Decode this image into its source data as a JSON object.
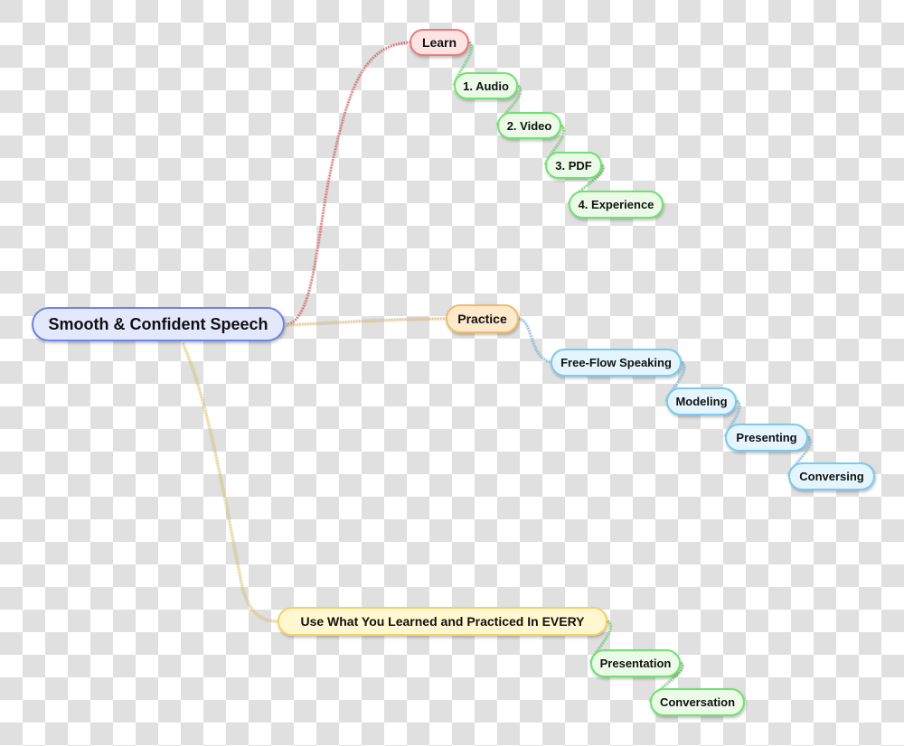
{
  "colors": {
    "root_border": "#6b86e6",
    "root_fill": "#e3e8fd",
    "learn_border": "#ec7a7a",
    "learn_fill": "#fde3e3",
    "learn_line": "#ee6b6b",
    "practice_border": "#f2bb6a",
    "practice_fill": "#fde9cc",
    "practice_line": "#f2c67c",
    "use_border": "#f2d36a",
    "use_fill": "#fff7cf",
    "use_line": "#f2d66f",
    "green_border": "#6fe36f",
    "green_fill": "#ebfbe8",
    "green_line": "#72e072",
    "blue_border": "#7ccaf0",
    "blue_fill": "#e4f5fd",
    "blue_line": "#7cc8ee"
  },
  "root": {
    "label": "Smooth & Confident Speech"
  },
  "branches": [
    {
      "label": "Learn",
      "children": [
        "1. Audio",
        "2. Video",
        "3. PDF",
        "4. Experience"
      ]
    },
    {
      "label": "Practice",
      "children": [
        "Free-Flow Speaking",
        "Modeling",
        "Presenting",
        "Conversing"
      ]
    },
    {
      "label": "Use What You Learned and Practiced In EVERY",
      "children": [
        "Presentation",
        "Conversation"
      ]
    }
  ]
}
